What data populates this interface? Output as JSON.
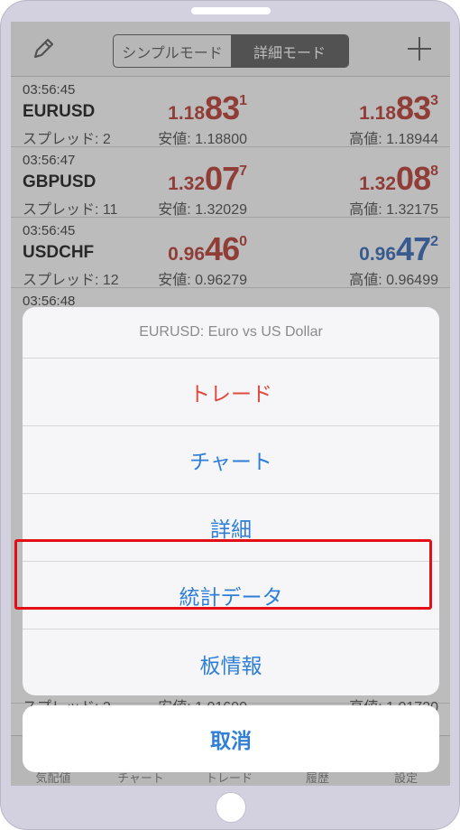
{
  "navbar": {
    "edit_icon": "pencil-icon",
    "segments": [
      "シンプルモード",
      "詳細モード"
    ],
    "selected_segment": "詳細モード",
    "add_icon": "plus-icon"
  },
  "quotes": [
    {
      "time": "03:56:45",
      "symbol": "EURUSD",
      "spread": "スプレッド: 2",
      "bid": {
        "small": "1.18",
        "big": "83",
        "sup": "1",
        "color": "red"
      },
      "ask": {
        "small": "1.18",
        "big": "83",
        "sup": "3",
        "color": "red"
      },
      "low": "安値: 1.18800",
      "high": "高値: 1.18944"
    },
    {
      "time": "03:56:47",
      "symbol": "GBPUSD",
      "spread": "スプレッド: 11",
      "bid": {
        "small": "1.32",
        "big": "07",
        "sup": "7",
        "color": "red"
      },
      "ask": {
        "small": "1.32",
        "big": "08",
        "sup": "8",
        "color": "red"
      },
      "low": "安値: 1.32029",
      "high": "高値: 1.32175"
    },
    {
      "time": "03:56:45",
      "symbol": "USDCHF",
      "spread": "スプレッド: 12",
      "bid": {
        "small": "0.96",
        "big": "46",
        "sup": "0",
        "color": "red"
      },
      "ask": {
        "small": "0.96",
        "big": "47",
        "sup": "2",
        "color": "blue"
      },
      "low": "安値: 0.96279",
      "high": "高値: 0.96499"
    },
    {
      "time": "03:56:48",
      "symbol": "",
      "spread": "",
      "bid": {
        "small": "",
        "big": "",
        "sup": "",
        "color": "red"
      },
      "ask": {
        "small": "",
        "big": "",
        "sup": "",
        "color": "red"
      },
      "low": "",
      "high": ""
    }
  ],
  "partial_row": {
    "spread": "スプレッド: 2",
    "low": "安値: 1.01690",
    "high": "高値: 1.01720"
  },
  "tabbar": [
    "気配値",
    "チャート",
    "トレード",
    "履歴",
    "設定"
  ],
  "action_sheet": {
    "title": "EURUSD: Euro vs US Dollar",
    "actions": [
      "トレード",
      "チャート",
      "詳細",
      "統計データ",
      "板情報"
    ],
    "highlighted": "統計データ",
    "cancel": "取消"
  },
  "colors": {
    "red": "#b8332a",
    "blue": "#2a62b6",
    "action_blue": "#2f7fd8",
    "destructive": "#e04a3e",
    "highlight_border": "#e20f17"
  }
}
